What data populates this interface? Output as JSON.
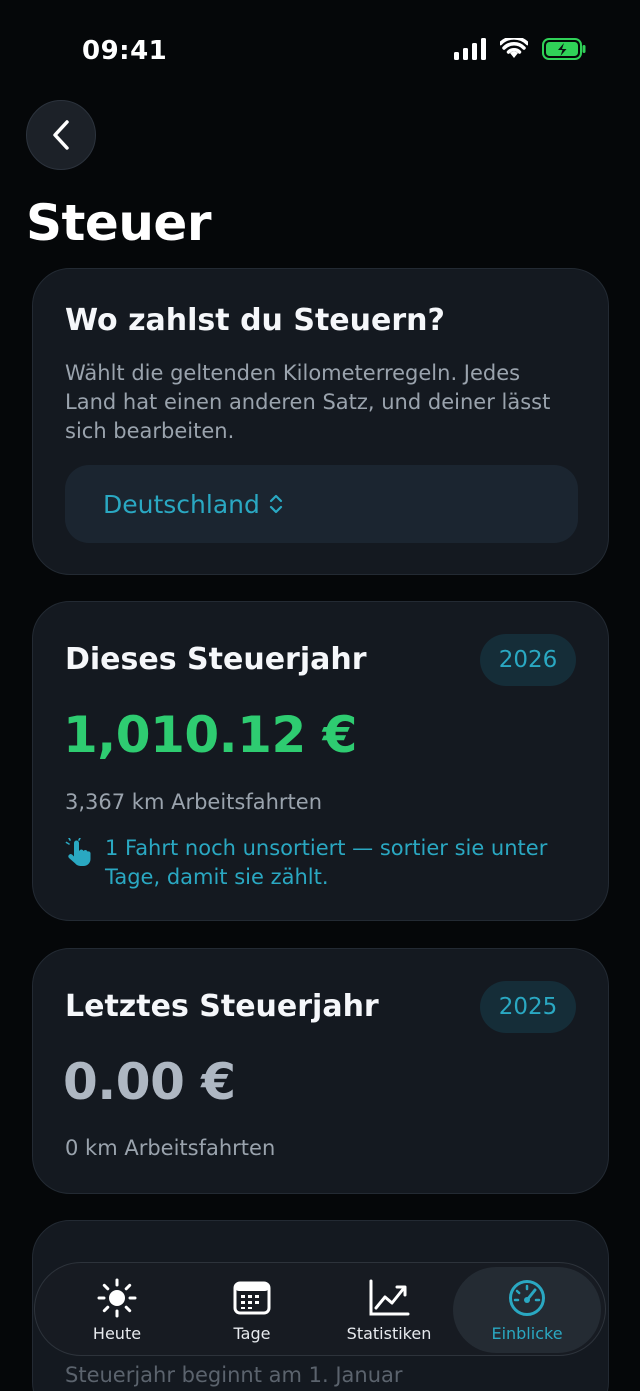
{
  "status_bar": {
    "time": "09:41"
  },
  "header": {
    "title": "Steuer"
  },
  "country_card": {
    "title": "Wo zahlst du Steuern?",
    "description": "Wählt die geltenden Kilometerregeln. Jedes Land hat einen anderen Satz, und deiner lässt sich bearbeiten.",
    "selected_country": "Deutschland"
  },
  "current_year_card": {
    "title": "Dieses Steuerjahr",
    "year": "2026",
    "amount": "1,010.12 €",
    "km": "3,367 km Arbeitsfahrten",
    "hint": "1 Fahrt noch unsortiert — sortier sie unter Tage, damit sie zählt."
  },
  "last_year_card": {
    "title": "Letztes Steuerjahr",
    "year": "2025",
    "amount": "0.00 €",
    "km": "0 km Arbeitsfahrten"
  },
  "next_card": {
    "subtitle": "Steuerjahr beginnt am 1. Januar"
  },
  "tabbar": {
    "items": [
      {
        "label": "Heute",
        "icon": "sun-icon"
      },
      {
        "label": "Tage",
        "icon": "calendar-icon"
      },
      {
        "label": "Statistiken",
        "icon": "chart-icon"
      },
      {
        "label": "Einblicke",
        "icon": "gauge-icon"
      }
    ],
    "active": "Einblicke"
  },
  "colors": {
    "accent": "#2aa8c2",
    "positive": "#2ecc71",
    "battery": "#30d158"
  }
}
